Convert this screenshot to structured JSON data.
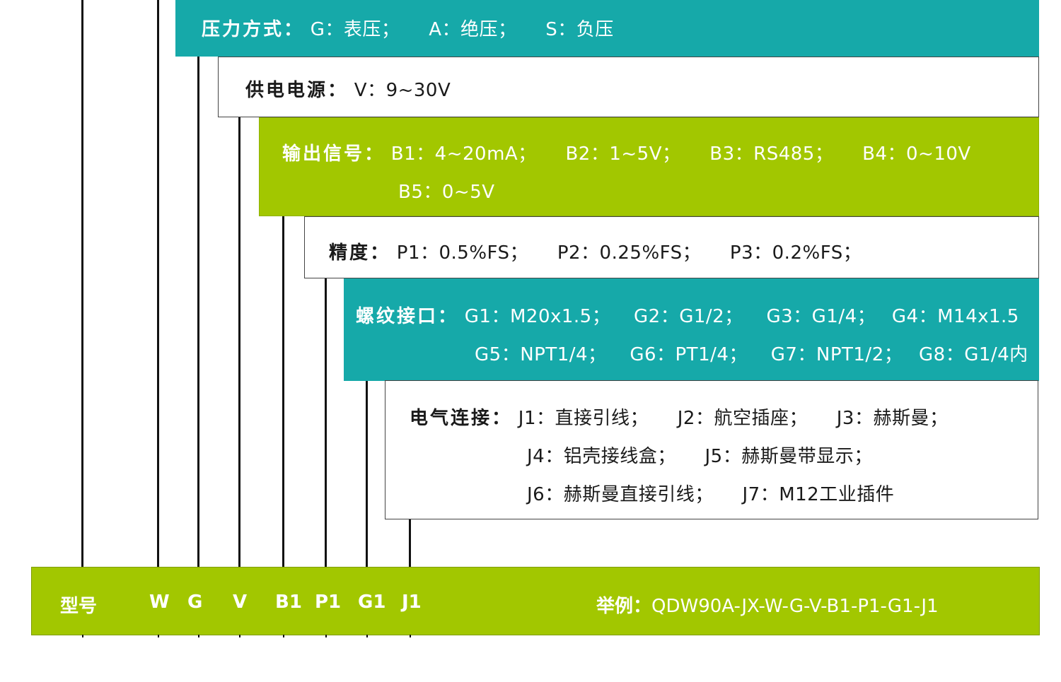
{
  "pressure_mode": {
    "label": "压力方式：",
    "options": [
      "G：表压；",
      "A：绝压；",
      "S：负压"
    ]
  },
  "power_supply": {
    "label": "供电电源：",
    "options": [
      "V：9~30V"
    ]
  },
  "output_signal": {
    "label": "输出信号：",
    "line1": [
      "B1：4~20mA；",
      "B2：1~5V；",
      "B3：RS485；",
      "B4：0~10V"
    ],
    "line2": [
      "B5：0~5V"
    ]
  },
  "accuracy": {
    "label": "精度：",
    "options": [
      "P1：0.5%FS；",
      "P2：0.25%FS；",
      "P3：0.2%FS；"
    ]
  },
  "thread_interface": {
    "label": "螺纹接口：",
    "line1": [
      "G1：M20x1.5；",
      "G2：G1/2；",
      "G3：G1/4；",
      "G4：M14x1.5"
    ],
    "line2": [
      "G5：NPT1/4；",
      "G6：PT1/4；",
      "G7：NPT1/2；",
      "G8：G1/4内"
    ]
  },
  "electrical_connection": {
    "label": "电气连接：",
    "line1": [
      "J1：直接引线；",
      "J2：航空插座；",
      "J3：赫斯曼；"
    ],
    "line2": [
      "J4：铝壳接线盒；",
      "J5：赫斯曼带显示；"
    ],
    "line3": [
      "J6：赫斯曼直接引线；",
      "J7：M12工业插件"
    ]
  },
  "code_bar": {
    "model_label": "型号",
    "codes": [
      "W",
      "G",
      "V",
      "B1",
      "P1",
      "G1",
      "J1"
    ],
    "example_label": "举例：",
    "example_value": "QDW90A-JX-W-G-V-B1-P1-G1-J1"
  },
  "colors": {
    "teal": "#16a9a9",
    "green": "#a2c700",
    "line": "#111111"
  }
}
